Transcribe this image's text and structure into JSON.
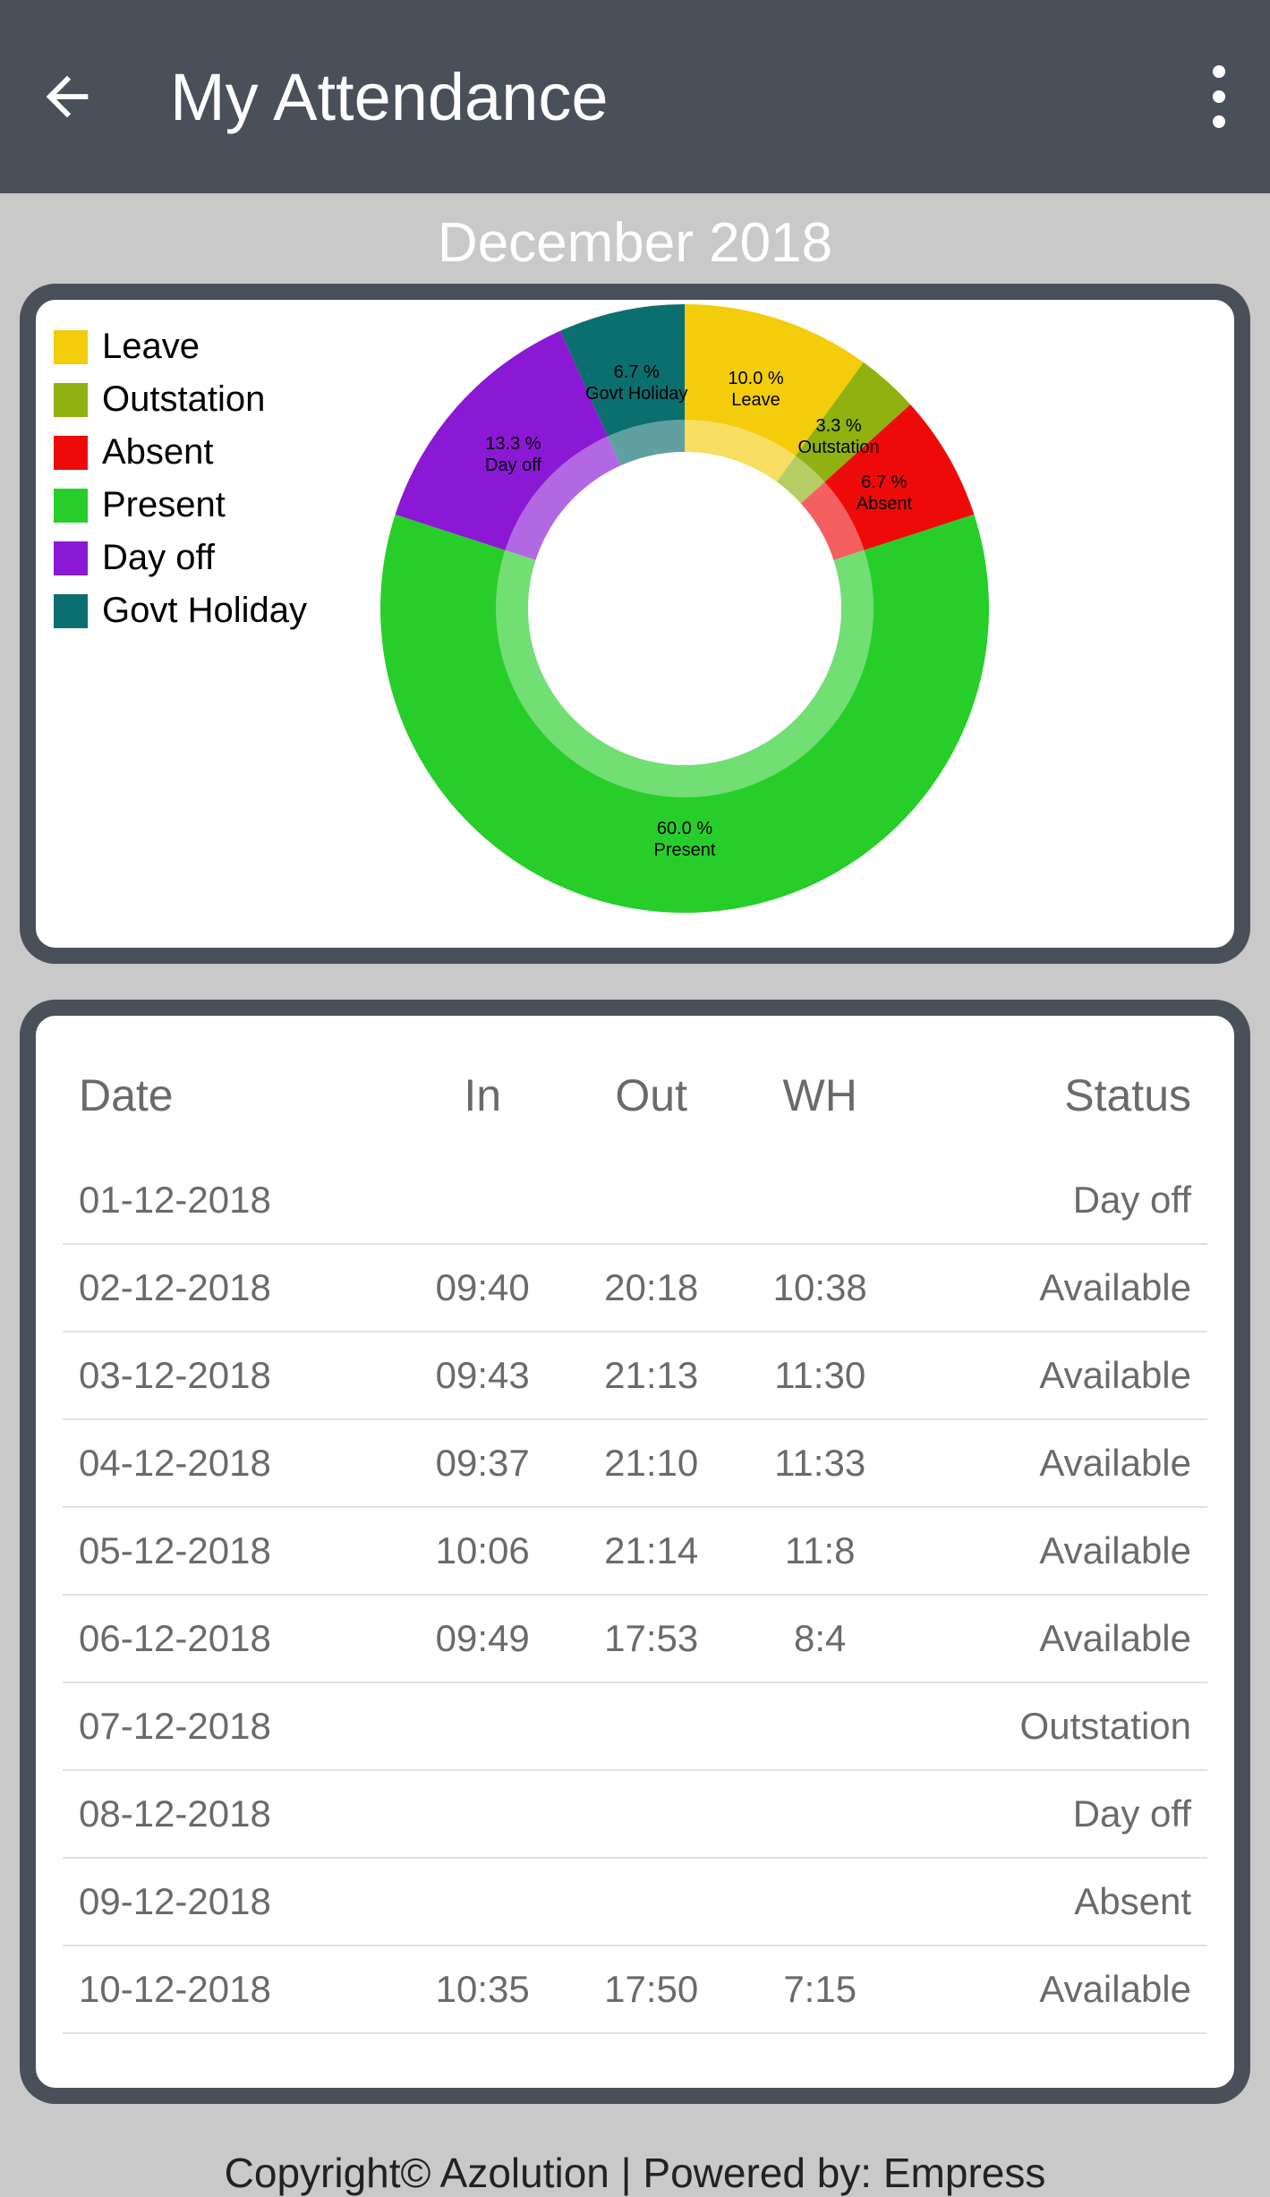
{
  "header": {
    "title": "My Attendance"
  },
  "month": "December 2018",
  "chart_data": {
    "type": "pie",
    "title": "",
    "series": [
      {
        "name": "Leave",
        "value": 10.0,
        "color": "#f3cc0b"
      },
      {
        "name": "Outstation",
        "value": 3.3,
        "color": "#8fb211"
      },
      {
        "name": "Absent",
        "value": 6.7,
        "color": "#ef0a0a"
      },
      {
        "name": "Present",
        "value": 60.0,
        "color": "#27ce2a"
      },
      {
        "name": "Day off",
        "value": 13.3,
        "color": "#8b18d4"
      },
      {
        "name": "Govt Holiday",
        "value": 6.7,
        "color": "#0b6e6f"
      }
    ]
  },
  "legend": {
    "items": [
      {
        "label": "Leave",
        "color": "#f3cc0b"
      },
      {
        "label": "Outstation",
        "color": "#8fb211"
      },
      {
        "label": "Absent",
        "color": "#ef0a0a"
      },
      {
        "label": "Present",
        "color": "#27ce2a"
      },
      {
        "label": "Day off",
        "color": "#8b18d4"
      },
      {
        "label": "Govt Holiday",
        "color": "#0b6e6f"
      }
    ]
  },
  "slice_labels": [
    {
      "pct": "10.0 %",
      "name": "Leave"
    },
    {
      "pct": "3.3 %",
      "name": "Outstation"
    },
    {
      "pct": "6.7 %",
      "name": "Absent"
    },
    {
      "pct": "60.0 %",
      "name": "Present"
    },
    {
      "pct": "13.3 %",
      "name": "Day off"
    },
    {
      "pct": "6.7 %",
      "name": "Govt Holiday"
    }
  ],
  "table": {
    "headers": {
      "date": "Date",
      "in": "In",
      "out": "Out",
      "wh": "WH",
      "status": "Status"
    },
    "rows": [
      {
        "date": "01-12-2018",
        "in": "",
        "out": "",
        "wh": "",
        "status": "Day off"
      },
      {
        "date": "02-12-2018",
        "in": "09:40",
        "out": "20:18",
        "wh": "10:38",
        "status": "Available"
      },
      {
        "date": "03-12-2018",
        "in": "09:43",
        "out": "21:13",
        "wh": "11:30",
        "status": "Available"
      },
      {
        "date": "04-12-2018",
        "in": "09:37",
        "out": "21:10",
        "wh": "11:33",
        "status": "Available"
      },
      {
        "date": "05-12-2018",
        "in": "10:06",
        "out": "21:14",
        "wh": "11:8",
        "status": "Available"
      },
      {
        "date": "06-12-2018",
        "in": "09:49",
        "out": "17:53",
        "wh": "8:4",
        "status": "Available"
      },
      {
        "date": "07-12-2018",
        "in": "",
        "out": "",
        "wh": "",
        "status": "Outstation"
      },
      {
        "date": "08-12-2018",
        "in": "",
        "out": "",
        "wh": "",
        "status": "Day off"
      },
      {
        "date": "09-12-2018",
        "in": "",
        "out": "",
        "wh": "",
        "status": "Absent"
      },
      {
        "date": "10-12-2018",
        "in": "10:35",
        "out": "17:50",
        "wh": "7:15",
        "status": "Available"
      }
    ]
  },
  "footer": "Copyright© Azolution | Powered by: Empress"
}
